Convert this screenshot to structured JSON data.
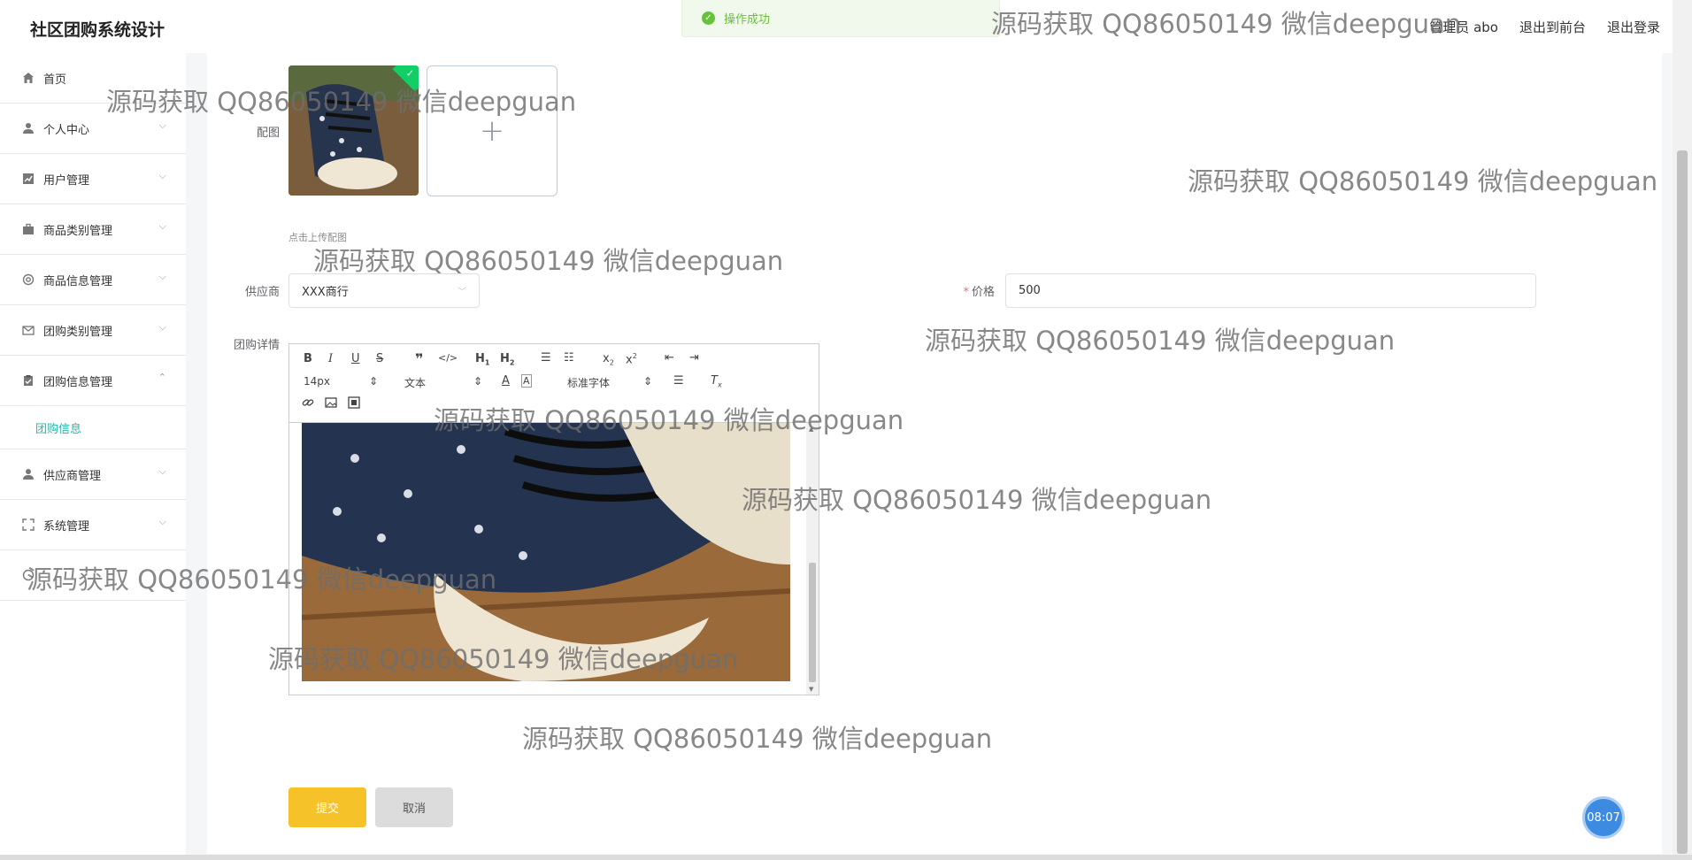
{
  "app": {
    "title": "社区团购系统设计"
  },
  "toast": {
    "message": "操作成功"
  },
  "header": {
    "user": "管理员 abo",
    "front": "退出到前台",
    "logout": "退出登录"
  },
  "sidebar": {
    "items": [
      {
        "label": "首页",
        "icon": "home-icon"
      },
      {
        "label": "个人中心",
        "icon": "user-icon"
      },
      {
        "label": "用户管理",
        "icon": "chart-icon"
      },
      {
        "label": "商品类别管理",
        "icon": "briefcase-icon"
      },
      {
        "label": "商品信息管理",
        "icon": "gear-icon"
      },
      {
        "label": "团购类别管理",
        "icon": "mail-icon"
      },
      {
        "label": "团购信息管理",
        "icon": "clipboard-icon"
      },
      {
        "label": "团购信息",
        "icon": ""
      },
      {
        "label": "供应商管理",
        "icon": "user-icon"
      },
      {
        "label": "系统管理",
        "icon": "expand-icon"
      },
      {
        "label": "",
        "icon": "circle-icon"
      }
    ]
  },
  "form": {
    "image_label": "配图",
    "upload_hint": "点击上传配图",
    "supplier_label": "供应商",
    "supplier_value": "XXX商行",
    "price_required": "*",
    "price_label": "价格",
    "price_value": "500",
    "detail_label": "团购详情"
  },
  "editor": {
    "font_size": "14px",
    "para": "文本",
    "font_family": "标准字体"
  },
  "buttons": {
    "submit": "提交",
    "cancel": "取消"
  },
  "clock": "08:07",
  "watermark": "源码获取 QQ86050149 微信deepguan"
}
